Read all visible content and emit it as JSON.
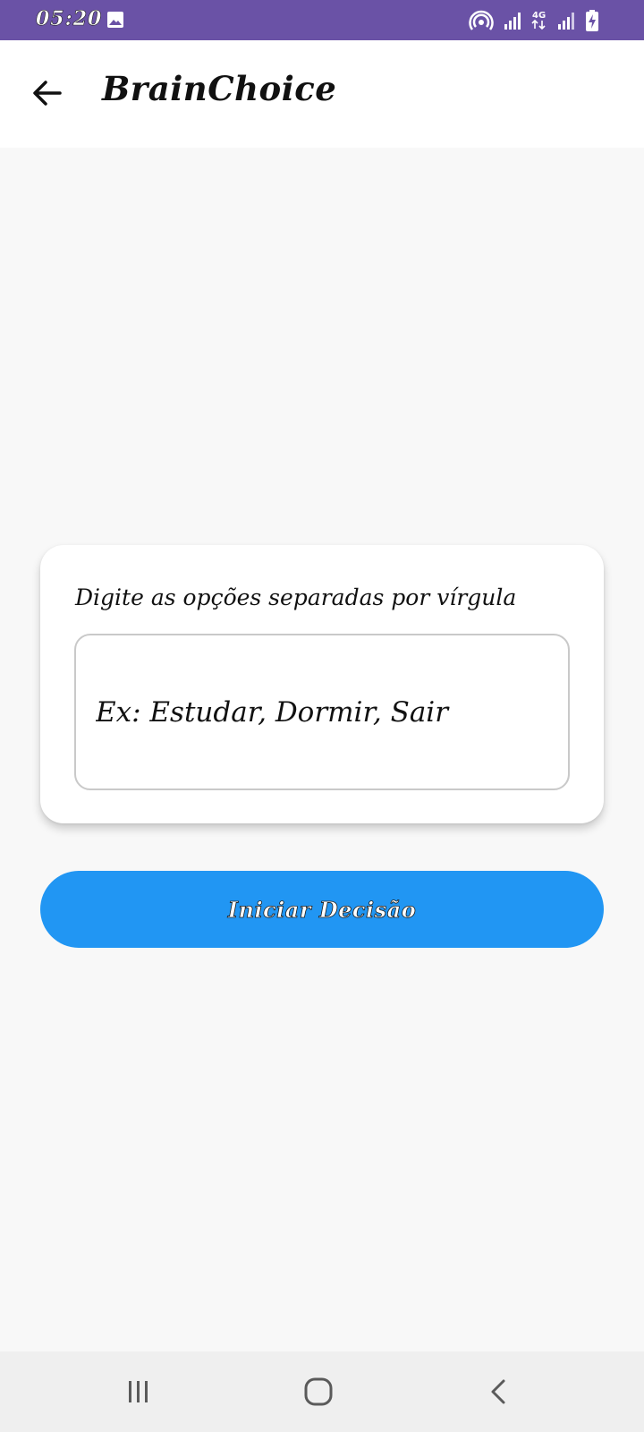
{
  "status_bar": {
    "time": "05:20",
    "background": "#6a52a6",
    "icons": [
      "gallery-icon",
      "hotspot-icon",
      "signal-icon",
      "4g-icon",
      "signal-icon",
      "battery-charging-icon"
    ],
    "network_label": "4G"
  },
  "app_bar": {
    "title": "BrainChoice",
    "back_icon": "arrow-left-icon"
  },
  "card": {
    "label": "Digite as opções separadas por vírgula",
    "input": {
      "value": "",
      "placeholder": "Ex: Estudar, Dormir, Sair"
    }
  },
  "primary_button": {
    "label": "Iniciar Decisão",
    "color": "#2196f3"
  },
  "nav_bar": {
    "icons": [
      "recent-apps-icon",
      "home-icon",
      "back-icon"
    ]
  }
}
